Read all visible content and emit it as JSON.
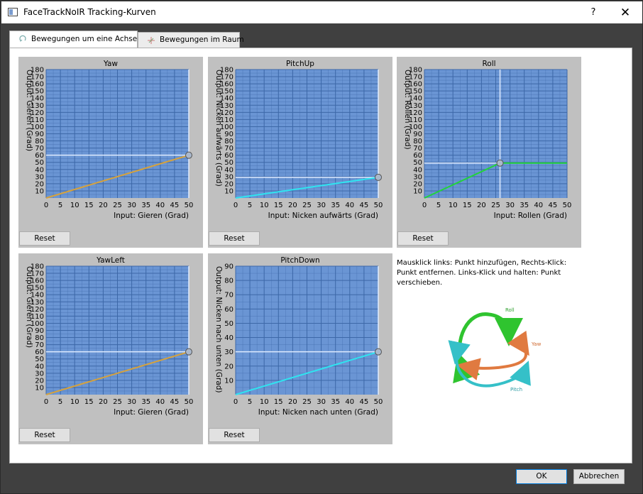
{
  "window": {
    "title": "FaceTrackNoIR Tracking-Kurven",
    "help_label": "?",
    "close_label": "✕"
  },
  "tabs": [
    {
      "label": "Bewegungen um eine Achse",
      "active": true
    },
    {
      "label": "Bewegungen im Raum",
      "active": false
    }
  ],
  "reset_label": "Reset",
  "help_text": "Mausklick links: Punkt hinzufügen, Rechts-Klick: Punkt entfernen. Links-Klick und halten: Punkt verschieben.",
  "legend": {
    "roll": "Roll",
    "yaw": "Yaw",
    "pitch": "Pitch"
  },
  "buttons": {
    "ok": "OK",
    "cancel": "Abbrechen"
  },
  "colors": {
    "plot_bg": "#6a95d4",
    "grid": "#3d68a8",
    "frame": "#c0c0c0",
    "yaw_curve": "#d6a23c",
    "pitch_curve": "#2fe4f0",
    "roll_curve": "#22d43a",
    "roll_arrow": "#2fc42f",
    "yaw_arrow": "#e07a40",
    "pitch_arrow": "#35c0c8"
  },
  "chart_data": [
    {
      "name": "Yaw",
      "type": "line",
      "xlabel": "Input: Gieren (Grad)",
      "ylabel": "Output: Gieren (Grad)",
      "xlim": [
        0,
        50
      ],
      "ylim": [
        0,
        180
      ],
      "x_ticks": [
        0,
        5,
        10,
        15,
        20,
        25,
        30,
        35,
        40,
        45,
        50
      ],
      "y_ticks": [
        10,
        20,
        30,
        40,
        50,
        60,
        70,
        80,
        90,
        100,
        110,
        120,
        130,
        140,
        150,
        160,
        170,
        180
      ],
      "points": [
        [
          0,
          0
        ],
        [
          50,
          60
        ]
      ],
      "color": "#d6a23c"
    },
    {
      "name": "PitchUp",
      "type": "line",
      "xlabel": "Input: Nicken aufwärts (Grad)",
      "ylabel": "Output: Nicken aufwärts (Grad)",
      "xlim": [
        0,
        50
      ],
      "ylim": [
        0,
        180
      ],
      "x_ticks": [
        0,
        5,
        10,
        15,
        20,
        25,
        30,
        35,
        40,
        45,
        50
      ],
      "y_ticks": [
        10,
        20,
        30,
        40,
        50,
        60,
        70,
        80,
        90,
        100,
        110,
        120,
        130,
        140,
        150,
        160,
        170,
        180
      ],
      "points": [
        [
          0,
          0
        ],
        [
          50,
          29
        ]
      ],
      "color": "#2fe4f0"
    },
    {
      "name": "Roll",
      "type": "line",
      "xlabel": "Input: Rollen (Grad)",
      "ylabel": "Output: Rollen (Grad)",
      "xlim": [
        0,
        50
      ],
      "ylim": [
        0,
        180
      ],
      "x_ticks": [
        0,
        5,
        10,
        15,
        20,
        25,
        30,
        35,
        40,
        45,
        50
      ],
      "y_ticks": [
        10,
        20,
        30,
        40,
        50,
        60,
        70,
        80,
        90,
        100,
        110,
        120,
        130,
        140,
        150,
        160,
        170,
        180
      ],
      "points": [
        [
          0,
          0
        ],
        [
          26.5,
          49
        ],
        [
          50,
          49
        ]
      ],
      "color": "#22d43a"
    },
    {
      "name": "YawLeft",
      "type": "line",
      "xlabel": "Input: Gieren (Grad)",
      "ylabel": "Output: Gieren (Grad)",
      "xlim": [
        0,
        50
      ],
      "ylim": [
        0,
        180
      ],
      "x_ticks": [
        0,
        5,
        10,
        15,
        20,
        25,
        30,
        35,
        40,
        45,
        50
      ],
      "y_ticks": [
        10,
        20,
        30,
        40,
        50,
        60,
        70,
        80,
        90,
        100,
        110,
        120,
        130,
        140,
        150,
        160,
        170,
        180
      ],
      "points": [
        [
          0,
          0
        ],
        [
          50,
          60
        ]
      ],
      "color": "#d6a23c"
    },
    {
      "name": "PitchDown",
      "type": "line",
      "xlabel": "Input: Nicken nach unten (Grad)",
      "ylabel": "Output: Nicken nach unten (Grad)",
      "xlim": [
        0,
        50
      ],
      "ylim": [
        0,
        90
      ],
      "x_ticks": [
        0,
        5,
        10,
        15,
        20,
        25,
        30,
        35,
        40,
        45,
        50
      ],
      "y_ticks": [
        10,
        20,
        30,
        40,
        50,
        60,
        70,
        80,
        90
      ],
      "points": [
        [
          0,
          0
        ],
        [
          50,
          30
        ]
      ],
      "color": "#2fe4f0"
    }
  ]
}
